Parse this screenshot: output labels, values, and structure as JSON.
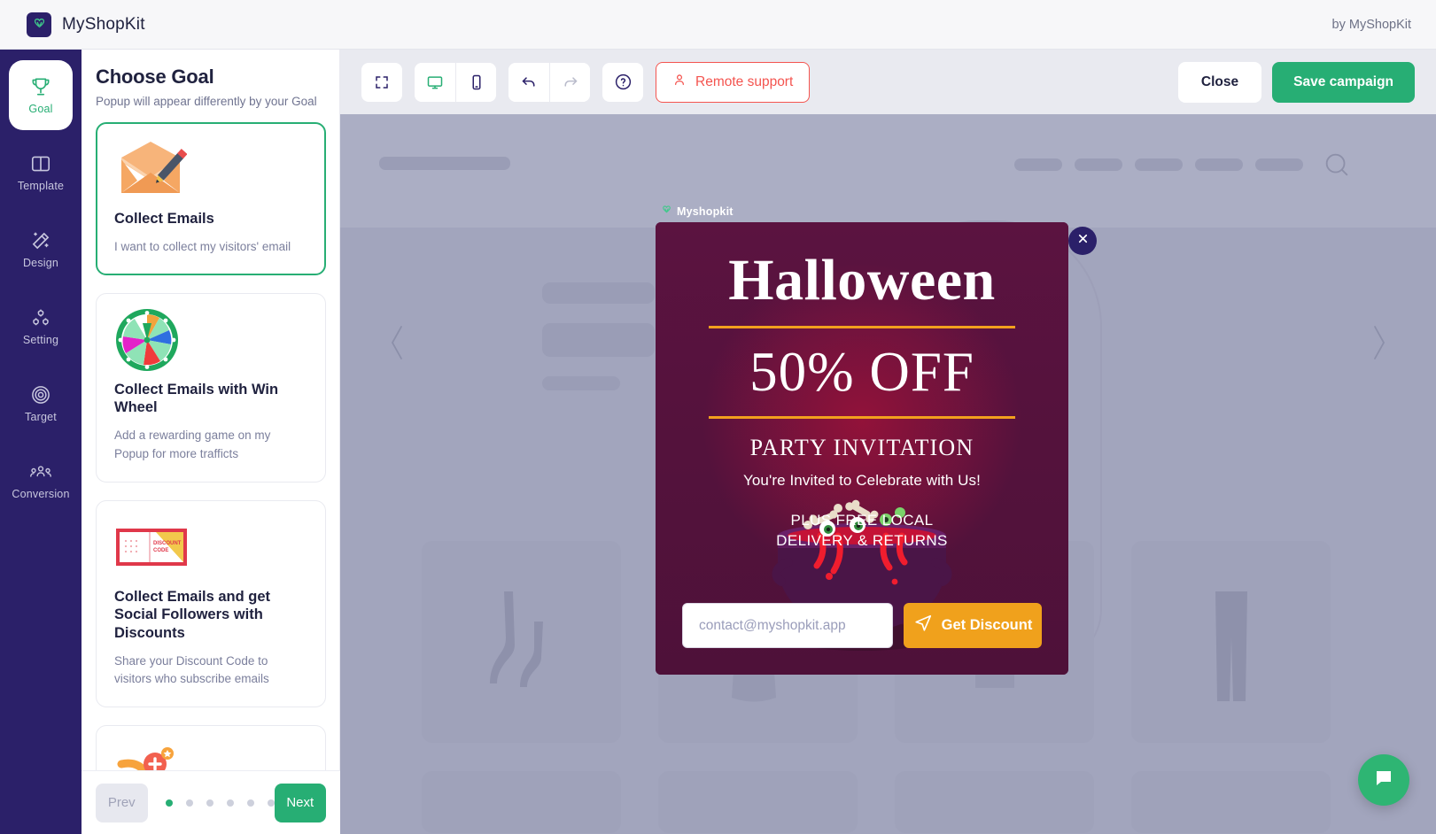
{
  "topbar": {
    "brand_name": "MyShopKit",
    "byline": "by MyShopKit",
    "logo_icon": "myshopkit-logo-icon"
  },
  "rail": {
    "items": [
      {
        "label": "Goal",
        "icon": "trophy-icon",
        "active": true
      },
      {
        "label": "Template",
        "icon": "layout-icon",
        "active": false
      },
      {
        "label": "Design",
        "icon": "magic-wand-icon",
        "active": false
      },
      {
        "label": "Setting",
        "icon": "gears-icon",
        "active": false
      },
      {
        "label": "Target",
        "icon": "target-icon",
        "active": false
      },
      {
        "label": "Conversion",
        "icon": "people-icon",
        "active": false
      }
    ]
  },
  "panel": {
    "title": "Choose Goal",
    "subtitle": "Popup will appear differently by your Goal",
    "cards": [
      {
        "name": "Collect Emails",
        "desc": "I want to collect my visitors' email",
        "icon": "envelope-pencil-icon",
        "selected": true
      },
      {
        "name": "Collect Emails with Win Wheel",
        "desc": "Add a rewarding game on my Popup for more trafficts",
        "icon": "spin-wheel-icon",
        "selected": false
      },
      {
        "name": "Collect Emails and get Social Followers with Discounts",
        "desc": "Share your Discount Code to visitors who subscribe emails",
        "icon": "discount-ticket-icon",
        "selected": false
      },
      {
        "name": "",
        "desc": "",
        "icon": "add-cart-icon",
        "selected": false
      }
    ]
  },
  "panel_footer": {
    "prev_label": "Prev",
    "next_label": "Next",
    "dots_total": 6,
    "dots_active_index": 0
  },
  "toolbar": {
    "fullscreen_icon": "fullscreen-icon",
    "desktop_icon": "desktop-icon",
    "mobile_icon": "mobile-icon",
    "undo_icon": "undo-icon",
    "redo_icon": "redo-icon",
    "help_icon": "question-circle-icon",
    "remote_support_label": "Remote support",
    "remote_support_icon": "user-icon",
    "close_label": "Close",
    "save_label": "Save campaign",
    "accent_green": "#27ae74",
    "accent_red": "#f4544f"
  },
  "popup": {
    "badge_label": "Myshopkit",
    "badge_icon": "myshopkit-mark-icon",
    "close_icon": "close-icon",
    "title": "Halloween",
    "offer": "50% OFF",
    "party": "PARTY INVITATION",
    "invite": "You're Invited to Celebrate with Us!",
    "plus_line1": "PLUS FREE LOCAL",
    "plus_line2": "DELIVERY & RETURNS",
    "email_placeholder": "contact@myshopkit.app",
    "email_value": "",
    "cta_label": "Get Discount",
    "cta_icon": "send-icon",
    "bg_color": "#5a133f",
    "rule_color": "#f2a01e",
    "cta_color": "#f0a11c"
  },
  "preview": {
    "chat_icon": "chat-bubble-icon",
    "prev_arrow_icon": "chevron-left-icon",
    "next_arrow_icon": "chevron-right-icon",
    "search_icon": "search-icon",
    "nav_placeholder_count": 5,
    "product_placeholders": [
      "heels",
      "dress",
      "shirt",
      "pants"
    ]
  }
}
